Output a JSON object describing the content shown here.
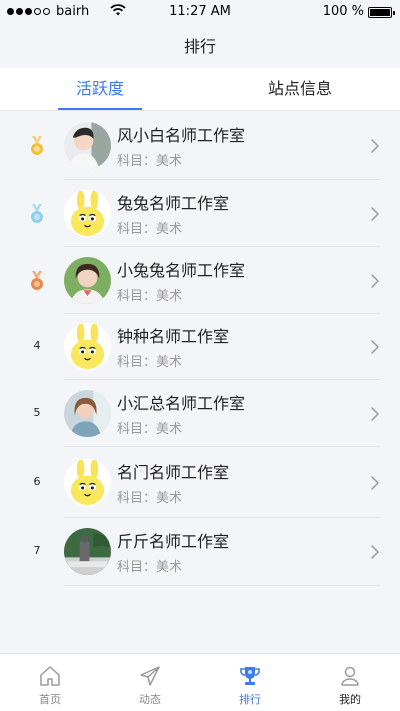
{
  "status": {
    "carrier": "bairh",
    "time": "11:27 AM",
    "battery": "100 %",
    "battery_level": 1.0
  },
  "nav": {
    "title": "排行"
  },
  "tabs": [
    {
      "label": "活跃度",
      "active": true
    },
    {
      "label": "站点信息",
      "active": false
    }
  ],
  "list": [
    {
      "rank": "",
      "medal": "gold",
      "name": "风小白名师工作室",
      "subject": "科目：美术",
      "avatar": "photo-man"
    },
    {
      "rank": "",
      "medal": "silver",
      "name": "兔兔名师工作室",
      "subject": "科目：美术",
      "avatar": "cartoon-rabbit"
    },
    {
      "rank": "",
      "medal": "bronze",
      "name": "小兔兔名师工作室",
      "subject": "科目：美术",
      "avatar": "photo-woman"
    },
    {
      "rank": "4",
      "medal": "",
      "name": "钟种名师工作室",
      "subject": "科目：美术",
      "avatar": "cartoon-rabbit"
    },
    {
      "rank": "5",
      "medal": "",
      "name": "小汇总名师工作室",
      "subject": "科目：美术",
      "avatar": "photo-woman-2"
    },
    {
      "rank": "6",
      "medal": "",
      "name": "名门名师工作室",
      "subject": "科目：美术",
      "avatar": "cartoon-rabbit"
    },
    {
      "rank": "7",
      "medal": "",
      "name": "斤斤名师工作室",
      "subject": "科目：美术",
      "avatar": "photo-statue"
    }
  ],
  "bottom_nav": [
    {
      "label": "首页",
      "icon": "home-icon"
    },
    {
      "label": "动态",
      "icon": "send-icon"
    },
    {
      "label": "排行",
      "icon": "trophy-icon",
      "active": true
    },
    {
      "label": "我的",
      "icon": "user-icon"
    }
  ],
  "colors": {
    "accent": "#3a7bf0",
    "gold": "#f2c23c",
    "silver": "#8fd0ea",
    "bronze": "#e98a4a"
  }
}
